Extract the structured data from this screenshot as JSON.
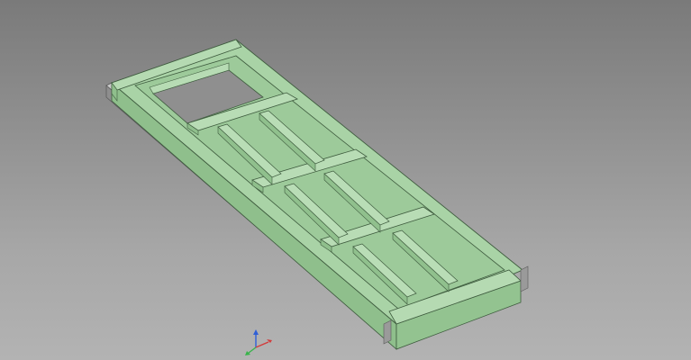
{
  "viewport": {
    "background_top": "#7a7a7a",
    "background_bottom": "#b3b3b3"
  },
  "model": {
    "part_color": "#a9d3a6",
    "part_dark": "#8fbf8c",
    "part_edge": "#3e5b3e",
    "rail_color": "#c8c8c8",
    "rail_dark": "#8d8d8d"
  },
  "axis_gizmo": {
    "x_color": "#d23c3c",
    "y_color": "#38b44a",
    "z_color": "#2f5fd7"
  }
}
